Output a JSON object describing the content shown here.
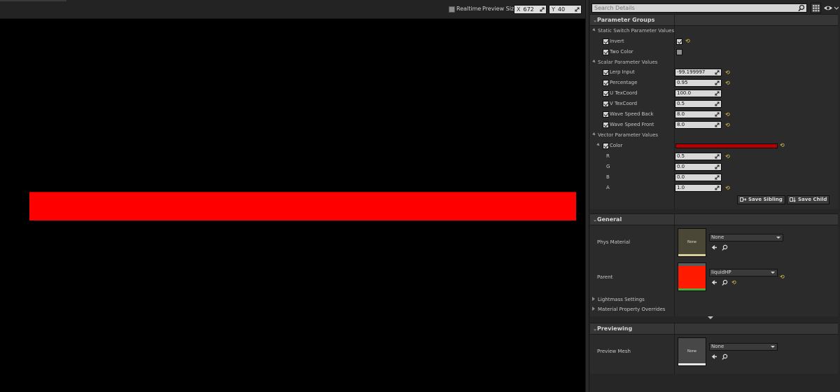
{
  "viewport": {
    "realtime_label": "Realtime",
    "preview_size_label": "Preview Size",
    "x_axis": "X",
    "x_value": "672",
    "y_axis": "Y",
    "y_value": "40",
    "preview_color": "#ff0000"
  },
  "details": {
    "search_placeholder": "Search Details",
    "parameter_groups": {
      "title": "Parameter Groups",
      "static_switch": {
        "title": "Static Switch Parameter Values",
        "params": [
          {
            "label": "Invert",
            "checked": true,
            "value_checked": true
          },
          {
            "label": "Two Color",
            "checked": true,
            "value_checked": false
          }
        ]
      },
      "scalar": {
        "title": "Scalar Parameter Values",
        "params": [
          {
            "label": "Lerp Input",
            "value": "-99.199997"
          },
          {
            "label": "Percentage",
            "value": "0.95"
          },
          {
            "label": "U TexCoord",
            "value": "100.0"
          },
          {
            "label": "V TexCoord",
            "value": "0.5"
          },
          {
            "label": "Wave Speed Back",
            "value": "8.0"
          },
          {
            "label": "Wave Speed Front",
            "value": "8.0"
          }
        ]
      },
      "vector": {
        "title": "Vector Parameter Values",
        "color_label": "Color",
        "color_hex": "#b30000",
        "channels": [
          {
            "label": "R",
            "value": "0.5"
          },
          {
            "label": "G",
            "value": "0.0"
          },
          {
            "label": "B",
            "value": "0.0"
          },
          {
            "label": "A",
            "value": "1.0"
          }
        ]
      },
      "save_sibling": "Save Sibling",
      "save_child": "Save Child"
    },
    "general": {
      "title": "General",
      "phys_material_label": "Phys Material",
      "phys_material_thumb": "None",
      "phys_material_value": "None",
      "parent_label": "Parent",
      "parent_value": "liquidHP",
      "lightmass_settings": "Lightmass Settings",
      "material_property_overrides": "Material Property Overrides"
    },
    "previewing": {
      "title": "Previewing",
      "preview_mesh_label": "Preview Mesh",
      "preview_mesh_thumb": "None",
      "preview_mesh_value": "None"
    }
  }
}
